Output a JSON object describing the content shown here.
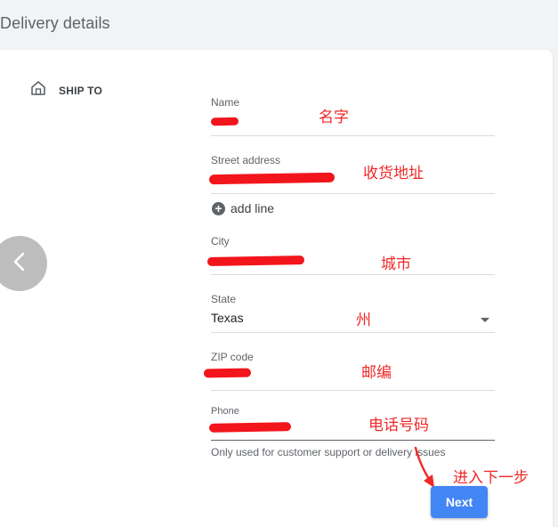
{
  "page": {
    "title": "Delivery details"
  },
  "ship_to": {
    "label": "SHIP TO",
    "icon": "home-icon"
  },
  "form": {
    "name": {
      "label": "Name",
      "annotation": "名字"
    },
    "street": {
      "label": "Street address",
      "annotation": "收货地址"
    },
    "add_line": {
      "label": "add line"
    },
    "city": {
      "label": "City",
      "annotation": "城市"
    },
    "state": {
      "label": "State",
      "value": "Texas",
      "annotation": "州"
    },
    "zip": {
      "label": "ZIP code",
      "annotation": "邮编"
    },
    "phone": {
      "label": "Phone",
      "annotation": "电话号码",
      "helper": "Only used for customer support or delivery issues"
    }
  },
  "next": {
    "label": "Next",
    "annotation": "进入下一步"
  },
  "colors": {
    "accent": "#4285f4",
    "annotation_red": "#f02828"
  }
}
